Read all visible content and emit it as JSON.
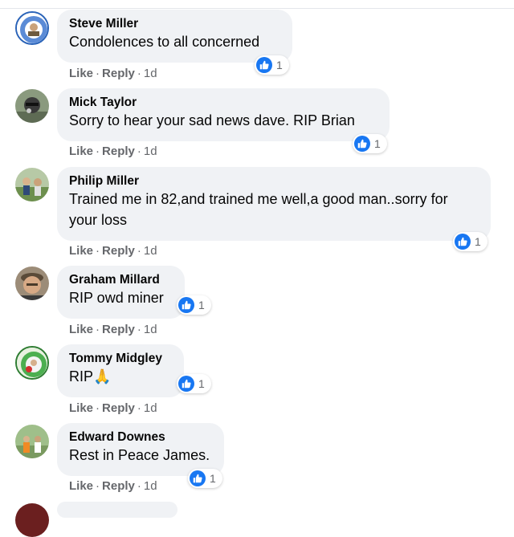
{
  "colors": {
    "bubble": "#f0f2f5",
    "like_blue": "#1877f2",
    "meta_text": "#65676b"
  },
  "icons": {
    "reaction": "thumbs-up-icon"
  },
  "comments": [
    {
      "author": "Steve Miller",
      "text": "Condolences to all concerned",
      "reactions": "1",
      "like": "Like",
      "reply": "Reply",
      "time": "1d"
    },
    {
      "author": "Mick Taylor",
      "text": "Sorry to hear your sad news dave. RIP Brian",
      "reactions": "1",
      "like": "Like",
      "reply": "Reply",
      "time": "1d"
    },
    {
      "author": "Philip Miller",
      "text": "Trained me in 82,and trained me well,a good man..sorry for your loss",
      "reactions": "1",
      "like": "Like",
      "reply": "Reply",
      "time": "1d"
    },
    {
      "author": "Graham Millard",
      "text": "RIP owd miner",
      "reactions": "1",
      "like": "Like",
      "reply": "Reply",
      "time": "1d"
    },
    {
      "author": "Tommy Midgley",
      "text": "RIP🙏",
      "reactions": "1",
      "like": "Like",
      "reply": "Reply",
      "time": "1d"
    },
    {
      "author": "Edward Downes",
      "text": "Rest in Peace James.",
      "reactions": "1",
      "like": "Like",
      "reply": "Reply",
      "time": "1d"
    }
  ]
}
